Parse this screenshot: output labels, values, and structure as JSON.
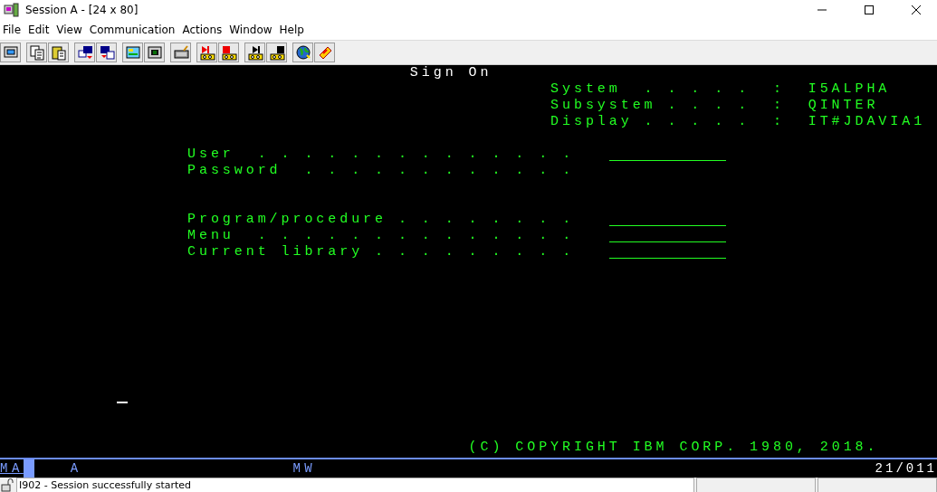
{
  "window": {
    "title": "Session A - [24 x 80]"
  },
  "menu": [
    "File",
    "Edit",
    "View",
    "Communication",
    "Actions",
    "Window",
    "Help"
  ],
  "terminal": {
    "title": "Sign On",
    "info": [
      {
        "label": "System  . . . . .  :",
        "value": "I5ALPHA"
      },
      {
        "label": "Subsystem . . . .  :",
        "value": "QINTER"
      },
      {
        "label": "Display . . . . .  :",
        "value": "IT#JDAVIA1"
      }
    ],
    "fields": [
      {
        "label": "User  . . . . . . . . . . . . . .",
        "underlined": true
      },
      {
        "label": "Password  . . . . . . . . . . . .",
        "underlined": false
      },
      {
        "label": "Program/procedure . . . . . . . .",
        "underlined": true
      },
      {
        "label": "Menu  . . . . . . . . . . . . . .",
        "underlined": true
      },
      {
        "label": "Current library . . . . . . . . .",
        "underlined": true
      }
    ],
    "copyright": "(C) COPYRIGHT IBM CORP. 1980, 2018."
  },
  "oia": {
    "mode": "MA",
    "input": "A",
    "message_wait": "MW",
    "cursor_position": "21/011"
  },
  "status_bar": {
    "message": "I902 - Session successfully started"
  }
}
